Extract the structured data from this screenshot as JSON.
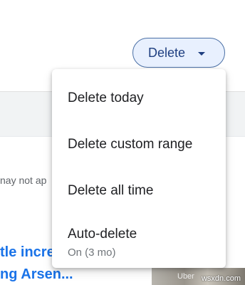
{
  "toolbar": {
    "delete_button_label": "Delete"
  },
  "background": {
    "snippet_text": "nay not ap",
    "link_line_1": "tle incre",
    "link_line_2": "ng Arsen...",
    "thumb_text": "Uber"
  },
  "menu": {
    "items": [
      {
        "label": "Delete today"
      },
      {
        "label": "Delete custom range"
      },
      {
        "label": "Delete all time"
      },
      {
        "label": "Auto-delete",
        "sublabel": "On (3 mo)"
      }
    ]
  },
  "watermark": "wsxdn.com",
  "colors": {
    "accent": "#1a73e8",
    "button_border": "#4a6fa5",
    "button_fill": "#e8f0fe"
  }
}
